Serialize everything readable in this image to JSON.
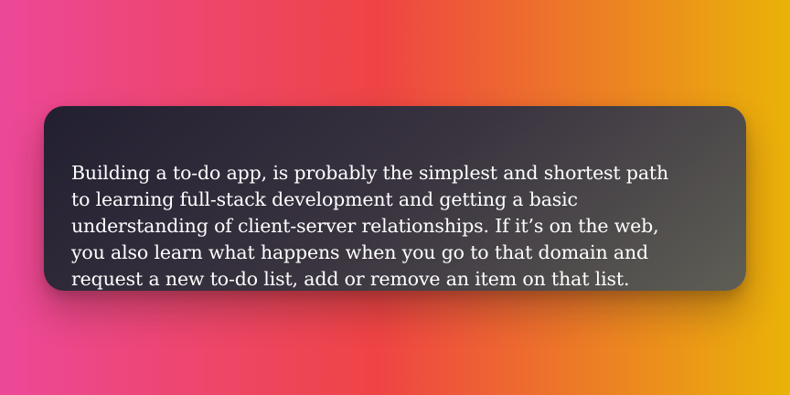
{
  "card": {
    "text_lines": [
      "Building a to-do app, is probably the simplest and shortest path",
      "to learning full-stack development and getting a basic",
      "understanding of client-server relationships. If it’s on the web,",
      "you also learn what happens when you go to that domain and",
      "request a new to-do list, add or remove an item on that list."
    ]
  },
  "colors": {
    "background_left": "#ec4899",
    "background_mid": "#ef4444",
    "background_right": "#eab308",
    "card_dark": "#221f31",
    "card_light": "#5f5e55",
    "text": "#ffffff"
  }
}
